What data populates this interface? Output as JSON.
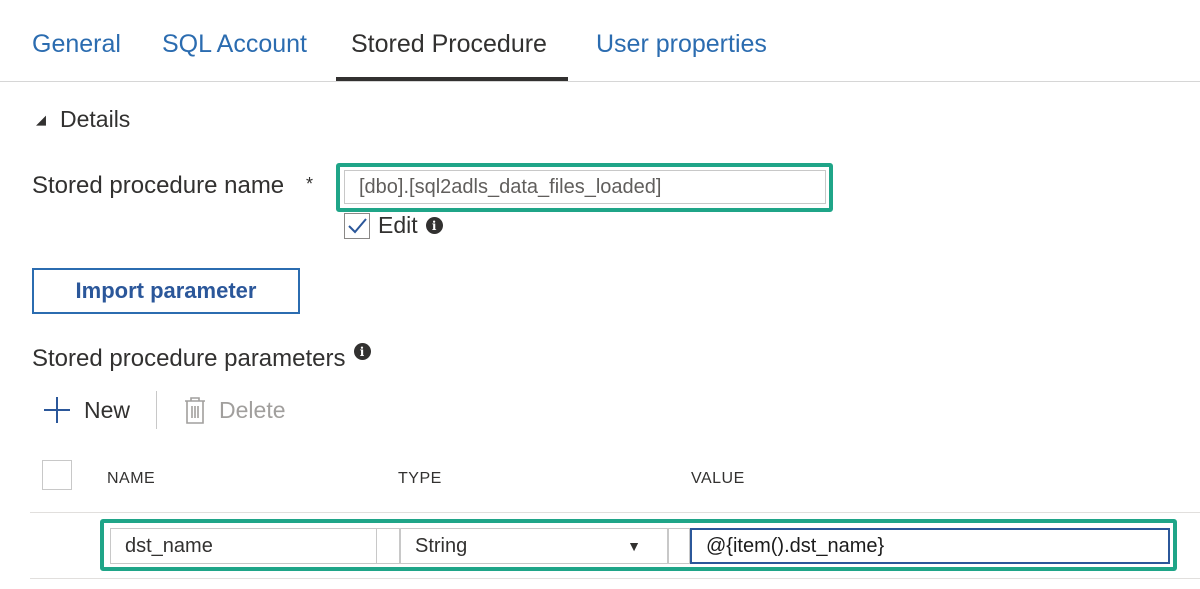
{
  "tabs": [
    {
      "label": "General"
    },
    {
      "label": "SQL Account"
    },
    {
      "label": "Stored Procedure"
    },
    {
      "label": "User properties"
    }
  ],
  "active_tab": "Stored Procedure",
  "details": {
    "header_label": "Details",
    "collapse_icon": "triangle-collapse-icon"
  },
  "stored_procedure": {
    "label": "Stored procedure name",
    "required_marker": "*",
    "value": "[dbo].[sql2adls_data_files_loaded]",
    "edit_label": "Edit",
    "edit_checked": true
  },
  "import_button": "Import parameter",
  "parameters": {
    "title": "Stored procedure parameters",
    "toolbar": {
      "new_label": "New",
      "delete_label": "Delete"
    },
    "columns": [
      "NAME",
      "TYPE",
      "VALUE"
    ],
    "rows": [
      {
        "name": "dst_name",
        "type": "String",
        "value": "@{item().dst_name}"
      }
    ]
  },
  "colors": {
    "accent_blue": "#2b6cb0",
    "highlight_green": "#1fa588",
    "text": "#323130"
  }
}
